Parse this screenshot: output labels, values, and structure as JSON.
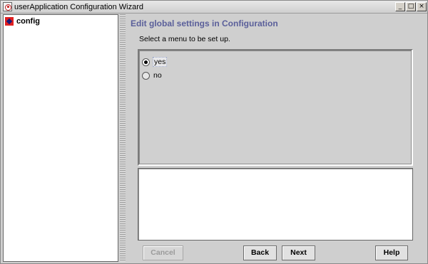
{
  "window": {
    "title": "userApplication Configuration Wizard",
    "controls": {
      "minimize": "_",
      "maximize": "□",
      "close": "×"
    }
  },
  "tree": {
    "items": [
      {
        "label": "config",
        "icon": "config-icon"
      }
    ]
  },
  "content": {
    "heading": "Edit global settings in Configuration",
    "subtitle": "Select a menu to be set up.",
    "options": [
      {
        "label": "yes",
        "selected": true
      },
      {
        "label": "no",
        "selected": false
      }
    ]
  },
  "buttons": {
    "cancel": "Cancel",
    "back": "Back",
    "next": "Next",
    "help": "Help"
  },
  "colors": {
    "heading": "#5a5f9a",
    "background": "#cfcfcf",
    "icon_red": "#e02020"
  }
}
